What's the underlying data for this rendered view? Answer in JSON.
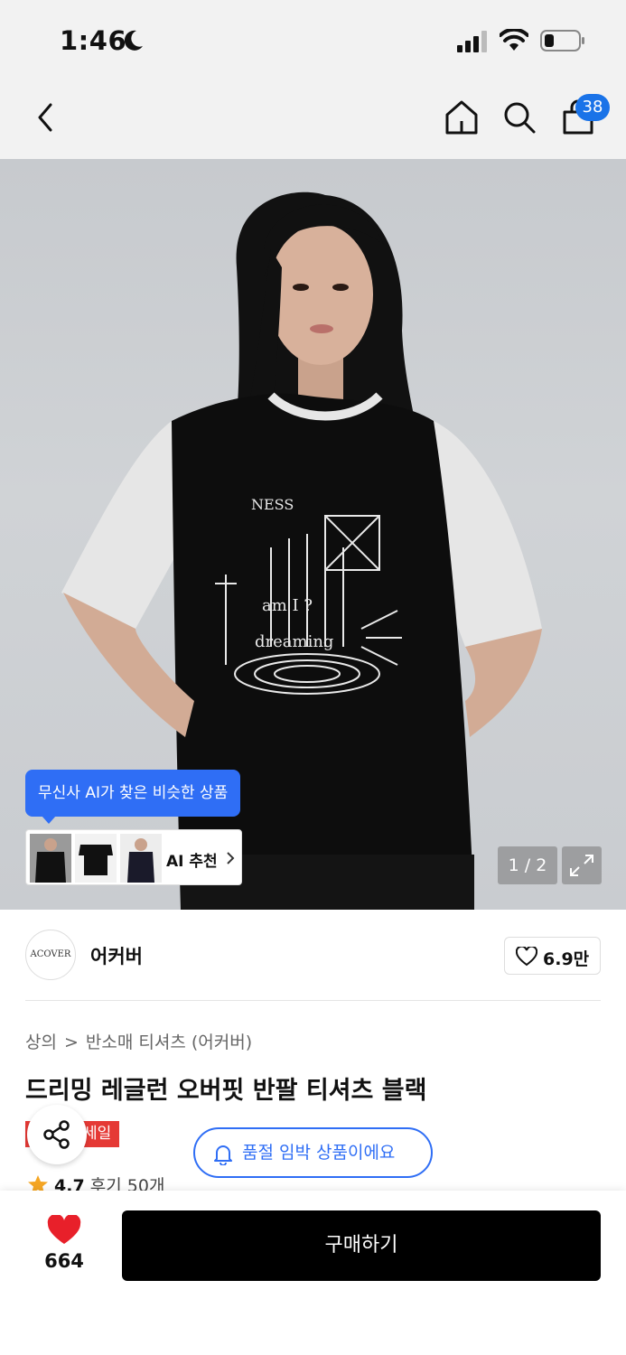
{
  "status_bar": {
    "time": "1:46"
  },
  "header": {
    "cart_count": "38"
  },
  "gallery": {
    "ai_tip": "무신사 AI가 찾은 비슷한 상품",
    "ai_label": "AI 추천",
    "page_indicator": "1 / 2"
  },
  "brand": {
    "logo_text": "ACOVER",
    "name": "어커버",
    "likes": "6.9만"
  },
  "breadcrumb": {
    "level1": "상의",
    "separator": ">",
    "level2": "반소매 티셔츠 (어커버)"
  },
  "product": {
    "title": "드리밍 레글런 오버핏 반팔 티셔츠 블랙",
    "sale_badge": "세일",
    "stock_message": "품절 임박 상품이에요",
    "rating": "4.7",
    "reviews": "후기 50개"
  },
  "bottom_bar": {
    "like_count": "664",
    "buy_label": "구매하기"
  },
  "colors": {
    "accent_blue": "#2f6ef5",
    "sale_red": "#e53935",
    "heart_red": "#e8202a"
  }
}
